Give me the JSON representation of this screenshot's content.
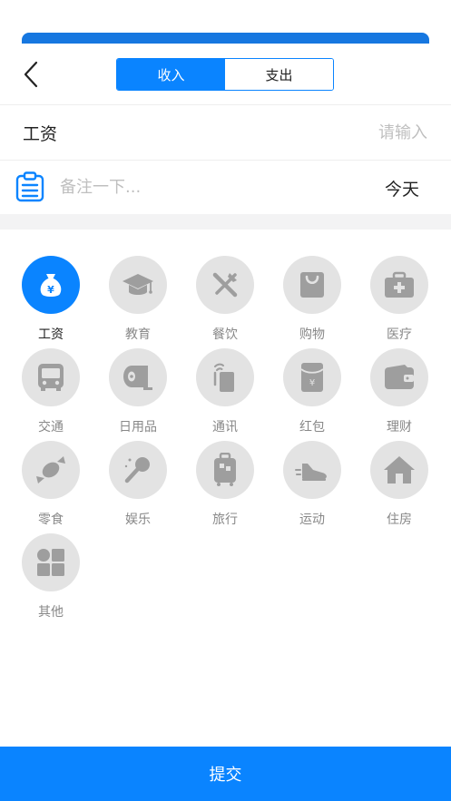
{
  "header": {
    "tabs": [
      {
        "label": "收入",
        "active": true
      },
      {
        "label": "支出",
        "active": false
      }
    ]
  },
  "amount": {
    "label": "工资",
    "placeholder": "请输入",
    "value": ""
  },
  "note": {
    "placeholder": "备注一下...",
    "date_label": "今天"
  },
  "categories": [
    {
      "label": "工资",
      "icon": "money-bag-icon",
      "active": true
    },
    {
      "label": "教育",
      "icon": "graduation-cap-icon",
      "active": false
    },
    {
      "label": "餐饮",
      "icon": "fork-knife-icon",
      "active": false
    },
    {
      "label": "购物",
      "icon": "shopping-bag-icon",
      "active": false
    },
    {
      "label": "医疗",
      "icon": "medical-kit-icon",
      "active": false
    },
    {
      "label": "交通",
      "icon": "bus-icon",
      "active": false
    },
    {
      "label": "日用品",
      "icon": "toilet-paper-icon",
      "active": false
    },
    {
      "label": "通讯",
      "icon": "phone-signal-icon",
      "active": false
    },
    {
      "label": "红包",
      "icon": "red-envelope-icon",
      "active": false
    },
    {
      "label": "理财",
      "icon": "wallet-icon",
      "active": false
    },
    {
      "label": "零食",
      "icon": "candy-icon",
      "active": false
    },
    {
      "label": "娱乐",
      "icon": "microphone-icon",
      "active": false
    },
    {
      "label": "旅行",
      "icon": "suitcase-icon",
      "active": false
    },
    {
      "label": "运动",
      "icon": "sneaker-icon",
      "active": false
    },
    {
      "label": "住房",
      "icon": "house-icon",
      "active": false
    },
    {
      "label": "其他",
      "icon": "grid-apps-icon",
      "active": false
    }
  ],
  "colors": {
    "primary": "#0a84ff",
    "icon_gray": "#9e9e9e",
    "circle_gray": "#e3e3e3"
  },
  "submit_label": "提交"
}
